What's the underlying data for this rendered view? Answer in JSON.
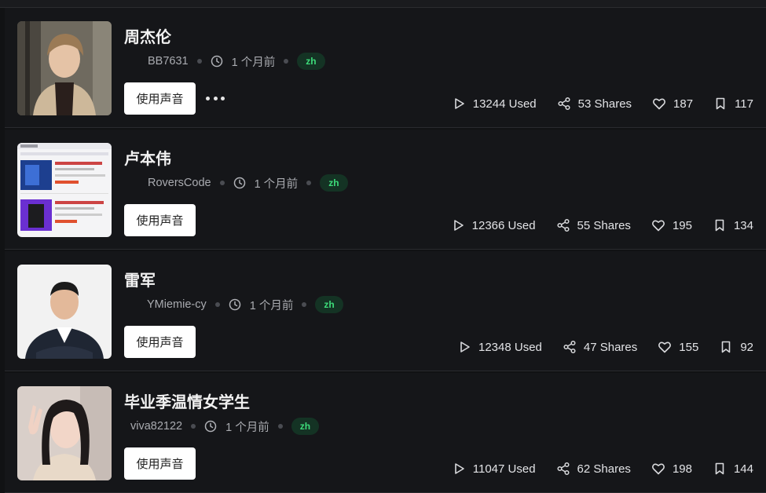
{
  "tracks": [
    {
      "title": "周杰伦",
      "author": "BB7631",
      "time": "1 个月前",
      "lang": "zh",
      "use_label": "使用声音",
      "has_more": true,
      "used": "13244 Used",
      "shares": "53 Shares",
      "likes": "187",
      "saves": "117",
      "thumb": "portrait-young-man"
    },
    {
      "title": "卢本伟",
      "author": "RoversCode",
      "time": "1 个月前",
      "lang": "zh",
      "use_label": "使用声音",
      "has_more": false,
      "used": "12366 Used",
      "shares": "55 Shares",
      "likes": "195",
      "saves": "134",
      "thumb": "product-listing-screenshot"
    },
    {
      "title": "雷军",
      "author": "YMiemie-cy",
      "time": "1 个月前",
      "lang": "zh",
      "use_label": "使用声音",
      "has_more": false,
      "used": "12348 Used",
      "shares": "47 Shares",
      "likes": "155",
      "saves": "92",
      "thumb": "man-in-suit"
    },
    {
      "title": "毕业季温情女学生",
      "author": "viva82122",
      "time": "1 个月前",
      "lang": "zh",
      "use_label": "使用声音",
      "has_more": false,
      "used": "11047 Used",
      "shares": "62 Shares",
      "likes": "198",
      "saves": "144",
      "thumb": "young-woman-peace-sign"
    }
  ],
  "colors": {
    "background": "#111214",
    "card": "#151619",
    "badge_bg": "#143324",
    "badge_text": "#3ddc7a",
    "button_bg": "#ffffff"
  }
}
